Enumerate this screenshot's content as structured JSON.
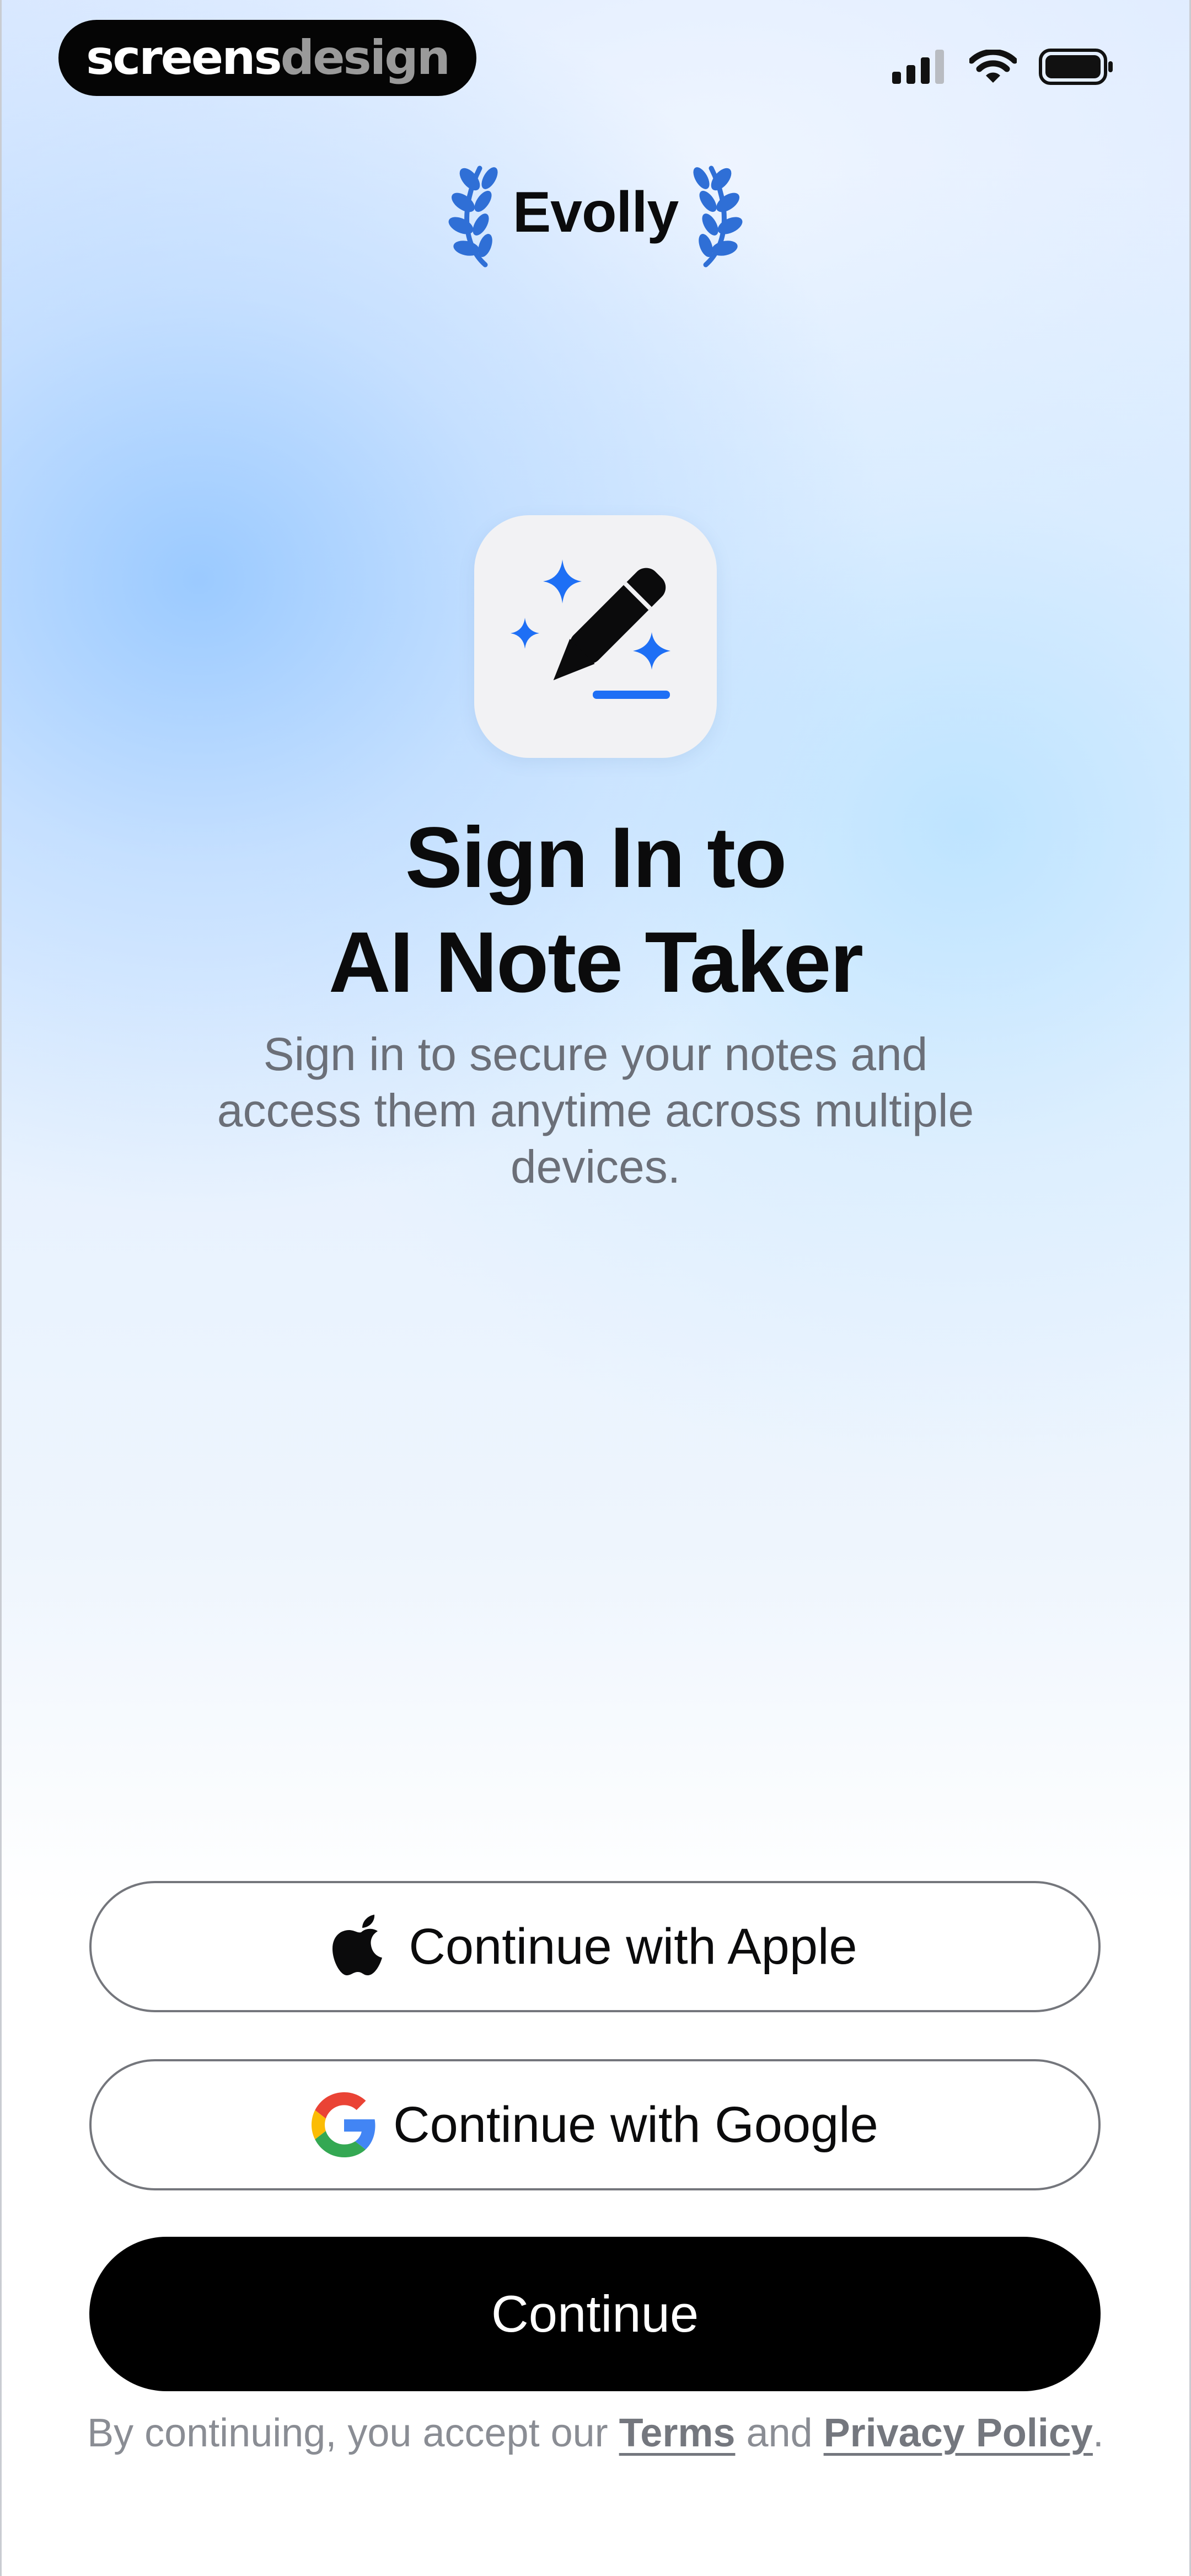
{
  "brand": {
    "part1": "screens",
    "part2": "design"
  },
  "status_bar": {
    "icons": [
      "cellular-signal-icon",
      "wifi-icon",
      "battery-icon"
    ]
  },
  "header": {
    "title": "Evolly",
    "icons": [
      "laurel-left-icon",
      "laurel-right-icon"
    ]
  },
  "app_icon": {
    "icon": "pencil-sparkle-icon"
  },
  "hero": {
    "title_line1": "Sign In to",
    "title_line2": "AI Note Taker",
    "subtitle": "Sign in to secure your notes and access them anytime across multiple devices."
  },
  "actions": {
    "apple_label": "Continue with Apple",
    "google_label": "Continue with Google",
    "continue_label": "Continue"
  },
  "legal": {
    "prefix": "By continuing, you accept our",
    "terms": "Terms",
    "and": "and",
    "privacy": "Privacy Policy",
    "suffix": "."
  },
  "colors": {
    "accent_blue": "#1e6ff5",
    "laurel_blue": "#2f6fd6",
    "button_primary": "#000000",
    "google_blue": "#4285F4",
    "google_red": "#EA4335",
    "google_yellow": "#FBBC05",
    "google_green": "#34A853"
  }
}
